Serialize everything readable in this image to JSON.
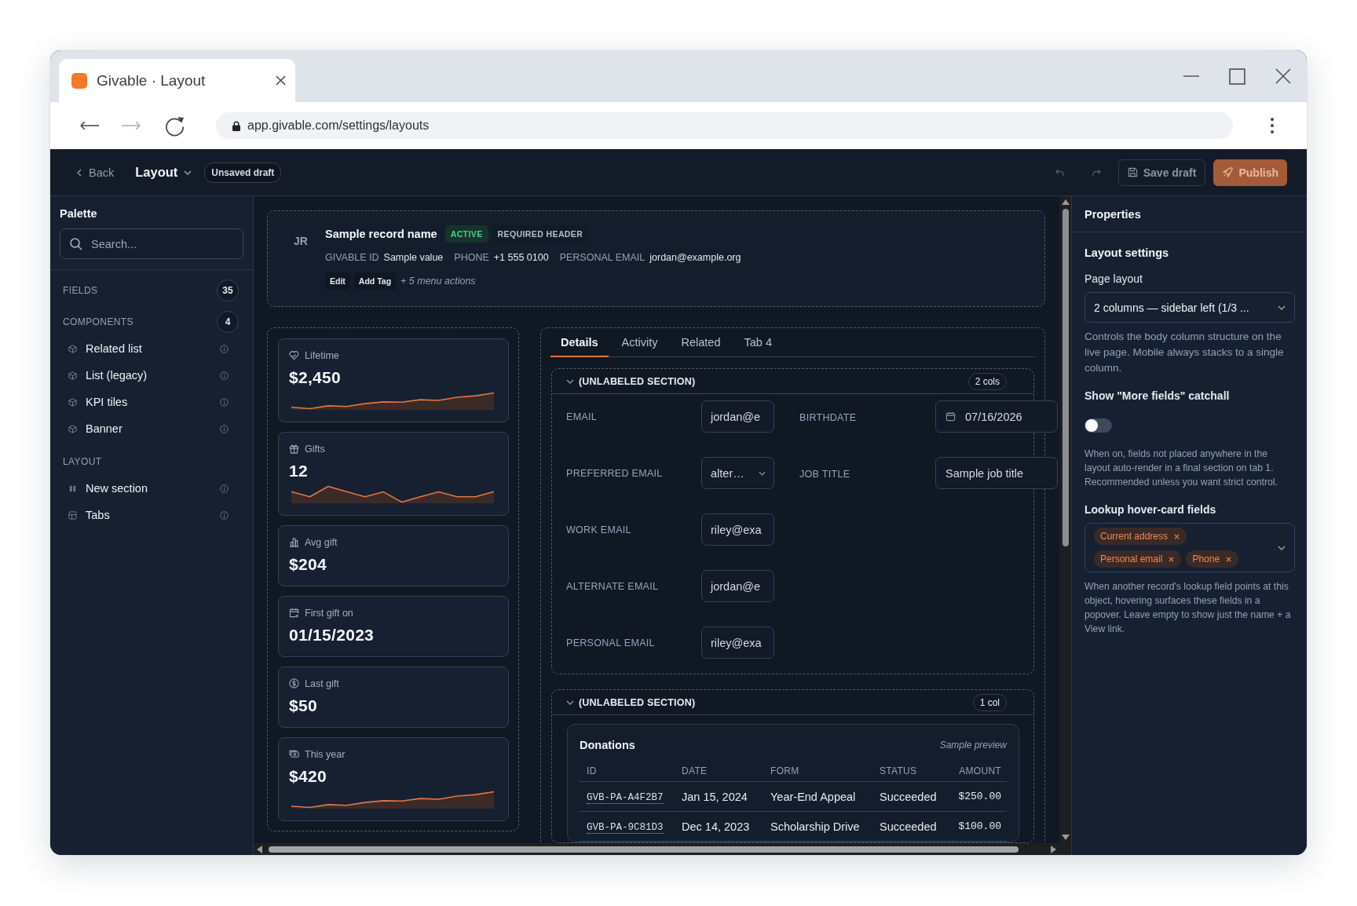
{
  "browser": {
    "tab_title": "Givable · Layout",
    "url": "app.givable.com/settings/layouts",
    "forward": {
      "disabled": true
    }
  },
  "app_header": {
    "back": "Back",
    "title": "Layout",
    "draft_badge": "Unsaved draft",
    "undo": {
      "disabled": true
    },
    "redo": {
      "disabled": true
    },
    "buttons": [
      {
        "label": "Save draft",
        "kind": "secondary",
        "disabled": true
      },
      {
        "label": "Publish",
        "kind": "primary",
        "disabled": true
      }
    ]
  },
  "palette": {
    "title": "Palette",
    "search": {
      "placeholder": "Search..."
    },
    "groups": [
      {
        "label": "FIELDS",
        "count": "35"
      },
      {
        "label": "COMPONENTS",
        "count": "4",
        "items": [
          "Related list",
          "List (legacy)",
          "KPI tiles",
          "Banner"
        ]
      },
      {
        "label": "LAYOUT",
        "items": [
          "New section",
          "Tabs"
        ]
      }
    ]
  },
  "record_header": {
    "avatar": "JR",
    "name": "Sample record name",
    "badges": [
      {
        "label": "ACTIVE",
        "kind": "status"
      },
      {
        "label": "REQUIRED HEADER",
        "kind": "tag"
      }
    ],
    "fields": [
      {
        "label": "GIVABLE ID",
        "value": "Sample value"
      },
      {
        "label": "PHONE",
        "value": "+1 555 0100"
      },
      {
        "label": "PERSONAL EMAIL",
        "value": "jordan@example.org"
      }
    ],
    "actions": [
      "Edit",
      "Add Tag"
    ],
    "more_actions": "+ 5 menu actions"
  },
  "kpi_tiles": [
    {
      "label": "Lifetime",
      "value": "$2,450",
      "kind": "trend"
    },
    {
      "label": "Gifts",
      "value": "12",
      "kind": "wave"
    },
    {
      "label": "Avg gift",
      "value": "$204",
      "kind": "plain"
    },
    {
      "label": "First gift on",
      "value": "01/15/2023",
      "kind": "plain"
    },
    {
      "label": "Last gift",
      "value": "$50",
      "kind": "plain"
    },
    {
      "label": "This year",
      "value": "$420",
      "kind": "trend"
    }
  ],
  "detail_tabs": [
    {
      "label": "Details",
      "selected": true
    },
    {
      "label": "Activity",
      "selected": false
    },
    {
      "label": "Related",
      "selected": false
    },
    {
      "label": "Tab 4",
      "selected": false
    }
  ],
  "sections": [
    {
      "kind": "fields",
      "title": "(UNLABELED SECTION)",
      "expanded": true,
      "columns_badge": "2 cols",
      "columns": [
        {
          "fields": [
            {
              "label": "EMAIL",
              "value": "jordan@e",
              "kind": "text"
            },
            {
              "label": "PREFERRED EMAIL",
              "value": "alter…",
              "kind": "select"
            },
            {
              "label": "WORK EMAIL",
              "value": "riley@exa",
              "kind": "text"
            },
            {
              "label": "ALTERNATE EMAIL",
              "value": "jordan@e",
              "kind": "text"
            },
            {
              "label": "PERSONAL EMAIL",
              "value": "riley@exa",
              "kind": "text"
            }
          ]
        },
        {
          "fields": [
            {
              "label": "BIRTHDATE",
              "value": "07/16/2026",
              "kind": "date"
            },
            {
              "label": "JOB TITLE",
              "value": "Sample job title",
              "kind": "text"
            }
          ]
        }
      ]
    },
    {
      "kind": "related_list",
      "title": "(UNLABELED SECTION)",
      "expanded": true,
      "columns_badge": "1 col",
      "list": {
        "title": "Donations",
        "note": "Sample preview",
        "columns": [
          "ID",
          "DATE",
          "FORM",
          "STATUS",
          "AMOUNT"
        ],
        "rows": [
          [
            "GVB-PA-A4F2B7",
            "Jan 15, 2024",
            "Year-End Appeal",
            "Succeeded",
            "$250.00"
          ],
          [
            "GVB-PA-9C81D3",
            "Dec 14, 2023",
            "Scholarship Drive",
            "Succeeded",
            "$100.00"
          ]
        ]
      }
    }
  ],
  "properties": {
    "title": "Properties",
    "group": "Layout settings",
    "page_layout": {
      "label": "Page layout",
      "value": "2 columns — sidebar left (1/3 ...",
      "help": "Controls the body column structure on the live page. Mobile always stacks to a single column."
    },
    "catchall": {
      "label": "Show \"More fields\" catchall",
      "on": false,
      "help": "When on, fields not placed anywhere in the layout auto-render in a final section on tab 1. Recommended unless you want strict control."
    },
    "hover_card_fields": {
      "label": "Lookup hover-card fields",
      "chips": [
        "Current address",
        "Personal email",
        "Phone"
      ],
      "help": "When another record's lookup field points at this object, hovering surfaces these fields in a popover. Leave empty to show just the name + a View link."
    }
  }
}
